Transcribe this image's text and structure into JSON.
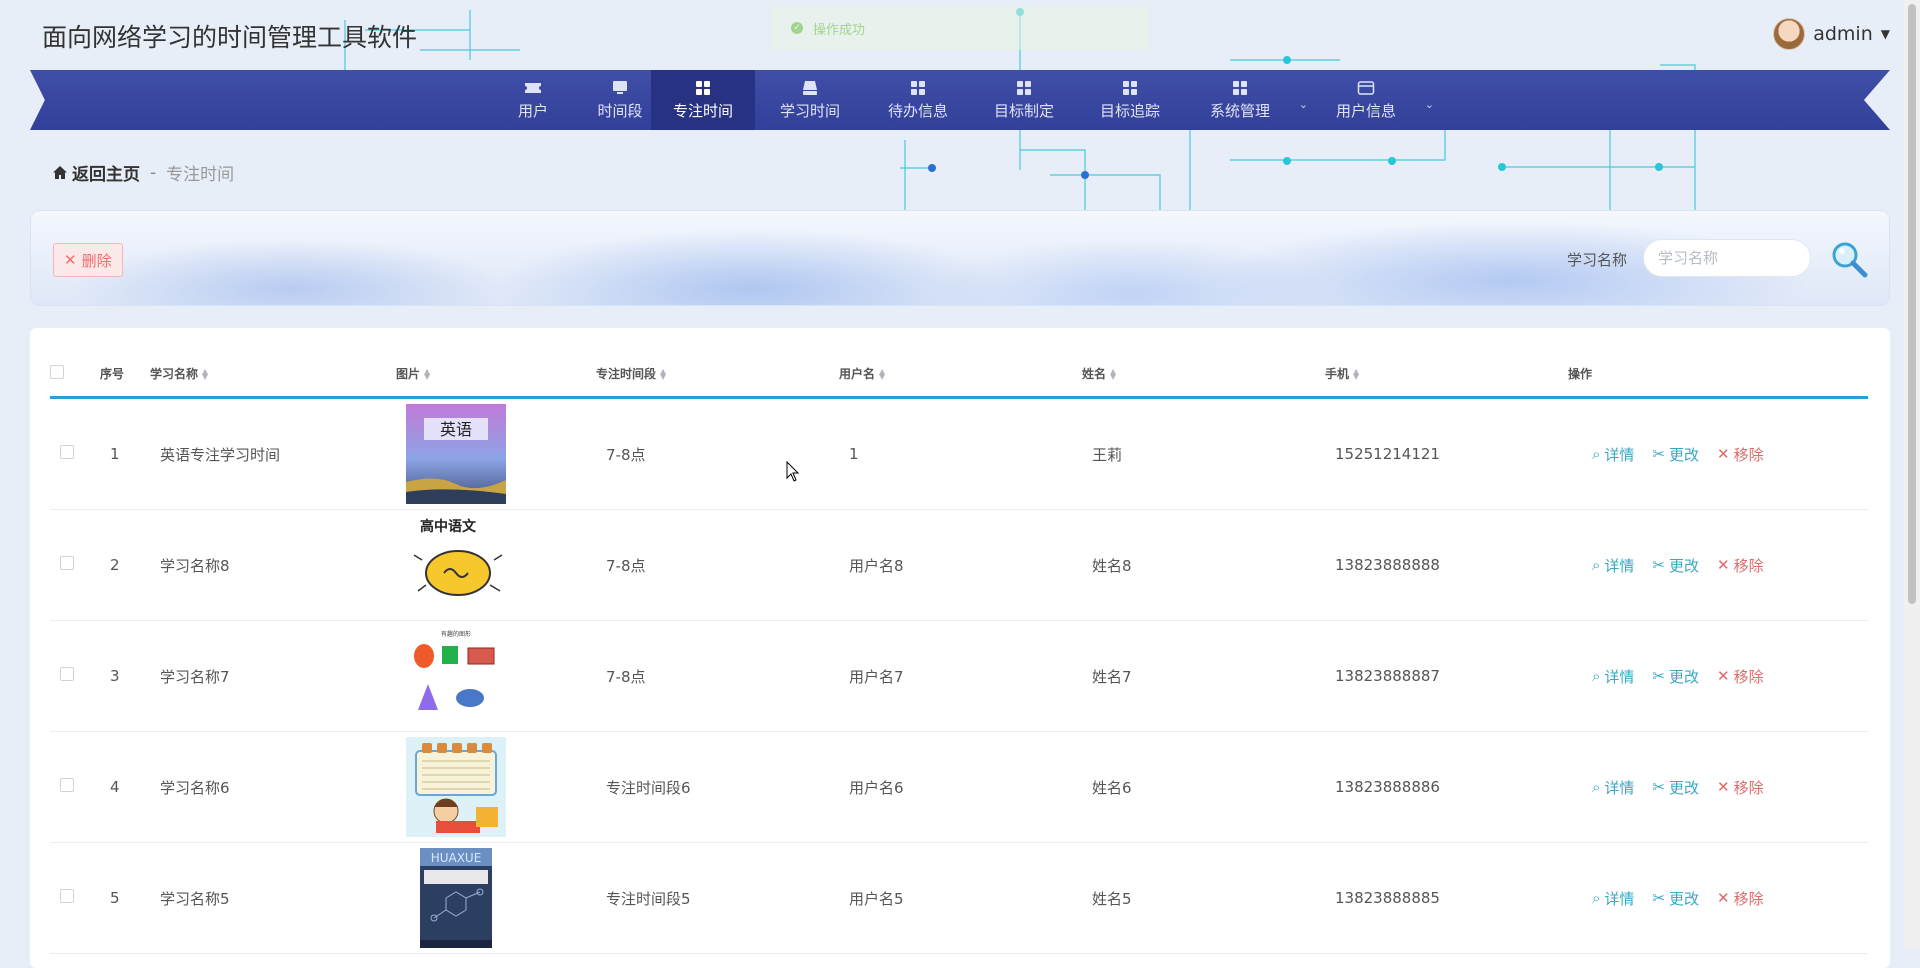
{
  "app": {
    "title": "面向网络学习的时间管理工具软件"
  },
  "toast": {
    "text": "操作成功"
  },
  "user": {
    "name": "admin"
  },
  "nav": {
    "items": [
      {
        "label": "用户",
        "icon": "ticket-icon"
      },
      {
        "label": "时间段",
        "icon": "monitor-icon"
      },
      {
        "label": "专注时间",
        "icon": "grid-icon",
        "active": true
      },
      {
        "label": "学习时间",
        "icon": "box-icon"
      },
      {
        "label": "待办信息",
        "icon": "grid-icon"
      },
      {
        "label": "目标制定",
        "icon": "grid-icon"
      },
      {
        "label": "目标追踪",
        "icon": "grid-icon"
      },
      {
        "label": "系统管理",
        "icon": "grid-icon",
        "dropdown": true
      },
      {
        "label": "用户信息",
        "icon": "card-icon",
        "dropdown": true
      }
    ]
  },
  "breadcrumb": {
    "home": "返回主页",
    "separator": "-",
    "current": "专注时间"
  },
  "toolbar": {
    "delete_label": "删除"
  },
  "search": {
    "label": "学习名称",
    "placeholder": "学习名称",
    "value": ""
  },
  "table": {
    "headers": [
      "序号",
      "学习名称",
      "图片",
      "专注时间段",
      "用户名",
      "姓名",
      "手机",
      "操作"
    ],
    "actions": {
      "detail": "详情",
      "edit": "更改",
      "remove": "移除"
    },
    "rows": [
      {
        "index": "1",
        "name": "英语专注学习时间",
        "image": "english-textbook",
        "image_text": "英语",
        "period": "7-8点",
        "username": "1",
        "realname": "王莉",
        "phone": "15251214121"
      },
      {
        "index": "2",
        "name": "学习名称8",
        "image": "chinese-cartoon",
        "image_text": "高中语文",
        "period": "7-8点",
        "username": "用户名8",
        "realname": "姓名8",
        "phone": "13823888888"
      },
      {
        "index": "3",
        "name": "学习名称7",
        "image": "shapes",
        "image_text": "有趣的图形",
        "period": "7-8点",
        "username": "用户名7",
        "realname": "姓名7",
        "phone": "13823888887"
      },
      {
        "index": "4",
        "name": "学习名称6",
        "image": "cartoon-boy-reading",
        "image_text": "",
        "period": "专注时间段6",
        "username": "用户名6",
        "realname": "姓名6",
        "phone": "13823888886"
      },
      {
        "index": "5",
        "name": "学习名称5",
        "image": "chemistry-book",
        "image_text": "HUAXUE",
        "period": "专注时间段5",
        "username": "用户名5",
        "realname": "姓名5",
        "phone": "13823888885"
      }
    ]
  },
  "colors": {
    "nav_bg": "#3f4ea6",
    "nav_active": "#273382",
    "accent": "#2a9fd6",
    "danger": "#f56c6c",
    "action": "#3aa8c4"
  }
}
